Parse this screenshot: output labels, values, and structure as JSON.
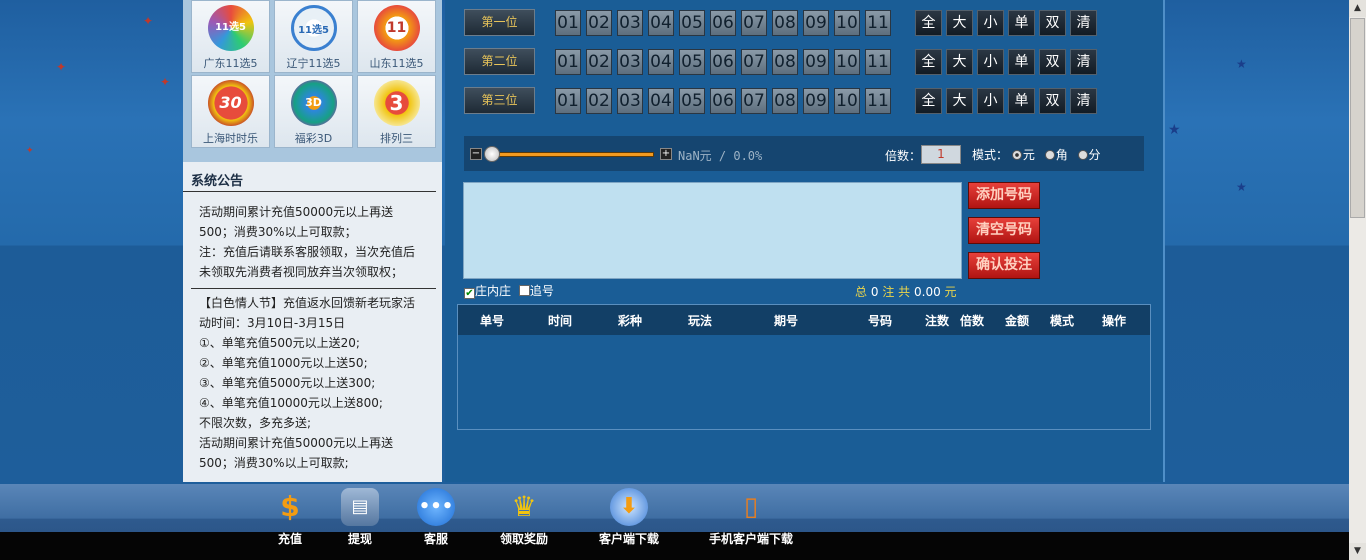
{
  "games": [
    {
      "name": "广东11选5",
      "logo_text": "11选5"
    },
    {
      "name": "辽宁11选5",
      "logo_text": "11选5"
    },
    {
      "name": "山东11选5",
      "logo_text": "11"
    },
    {
      "name": "上海时时乐",
      "logo_text": "30"
    },
    {
      "name": "福彩3D",
      "logo_text": "3D"
    },
    {
      "name": "排列三",
      "logo_text": "3"
    }
  ],
  "notice": {
    "title": "系统公告",
    "lines_top": [
      "活动期间累计充值50000元以上再送",
      "500；消费30%以上可取款；",
      "注：充值后请联系客服领取，当次充值后",
      "未领取先消费者视同放弃当次领取权；"
    ],
    "lines_bottom": [
      "【白色情人节】充值返水回馈新老玩家活",
      "动时间：3月10日-3月15日",
      "①、单笔充值500元以上送20;",
      "②、单笔充值1000元以上送50;",
      "③、单笔充值5000元以上送300;",
      "④、单笔充值10000元以上送800;",
      "不限次数，多充多送;",
      "活动期间累计充值50000元以上再送",
      "500；消费30%以上可取款;"
    ]
  },
  "positions": [
    "第一位",
    "第二位",
    "第三位"
  ],
  "numbers": [
    "01",
    "02",
    "03",
    "04",
    "05",
    "06",
    "07",
    "08",
    "09",
    "10",
    "11"
  ],
  "controls": [
    "全",
    "大",
    "小",
    "单",
    "双",
    "清"
  ],
  "slider": {
    "minus": "−",
    "plus": "+",
    "rebate": "NaN元 / 0.0%",
    "multiple_label": "倍数：",
    "multiple_value": "1",
    "mode_label": "模式：",
    "modes": [
      "元",
      "角",
      "分"
    ],
    "mode_selected": 0,
    "slider_level": 0
  },
  "buttons": {
    "add": "添加号码",
    "clear": "清空号码",
    "confirm": "确认投注"
  },
  "options": {
    "dealer": "庄内庄",
    "dealer_checked": true,
    "chase": "追号",
    "chase_checked": false
  },
  "total": {
    "prefix": "总",
    "bets": "0",
    "bets_unit": "注",
    "sum_prefix": "共",
    "amount": "0.00",
    "currency": "元"
  },
  "table_headers": [
    "单号",
    "时间",
    "彩种",
    "玩法",
    "期号",
    "号码",
    "注数",
    "倍数",
    "金额",
    "模式",
    "操作"
  ],
  "footer": [
    {
      "label": "充值",
      "icon": "dollar-icon"
    },
    {
      "label": "提现",
      "icon": "card-icon"
    },
    {
      "label": "客服",
      "icon": "chat-icon"
    },
    {
      "label": "领取奖励",
      "icon": "trophy-icon"
    },
    {
      "label": "客户端下载",
      "icon": "download-icon"
    },
    {
      "label": "手机客户端下载",
      "icon": "mobile-icon"
    }
  ],
  "colors": {
    "accent_red": "#c0392b",
    "gold": "#e8c45a",
    "panel_blue": "#1a5d96"
  }
}
